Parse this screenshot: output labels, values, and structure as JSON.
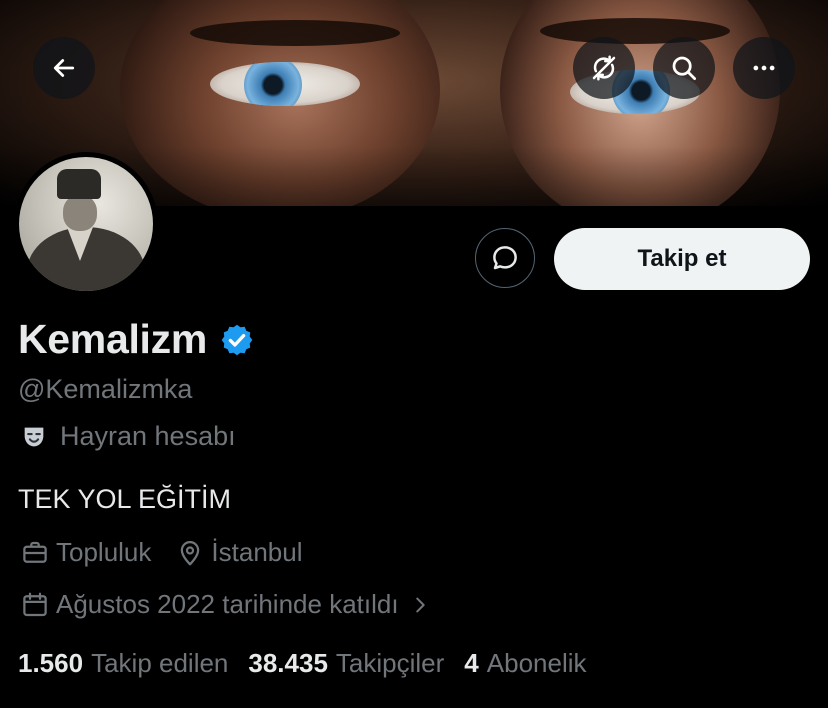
{
  "header": {
    "back_icon": "arrow-left-icon",
    "refresh_icon": "no-sync-icon",
    "search_icon": "search-icon",
    "more_icon": "more-horizontal-icon"
  },
  "profile": {
    "display_name": "Kemalizm",
    "verified": true,
    "verified_color": "#1d9bf0",
    "handle": "@Kemalizmka",
    "category_label": "Hayran hesabı",
    "bio": "TEK YOL EĞİTİM",
    "professional_category": "Topluluk",
    "location": "İstanbul",
    "joined": "Ağustos 2022 tarihinde katıldı"
  },
  "actions": {
    "follow_label": "Takip et",
    "message_icon": "message-bubble-icon"
  },
  "stats": {
    "following_count": "1.560",
    "following_label": "Takip edilen",
    "followers_count": "38.435",
    "followers_label": "Takipçiler",
    "subscriptions_count": "4",
    "subscriptions_label": "Abonelik"
  },
  "colors": {
    "background": "#000000",
    "primary_text": "#e7e9ea",
    "secondary_text": "#71767b",
    "follow_button_bg": "#eff3f4"
  }
}
